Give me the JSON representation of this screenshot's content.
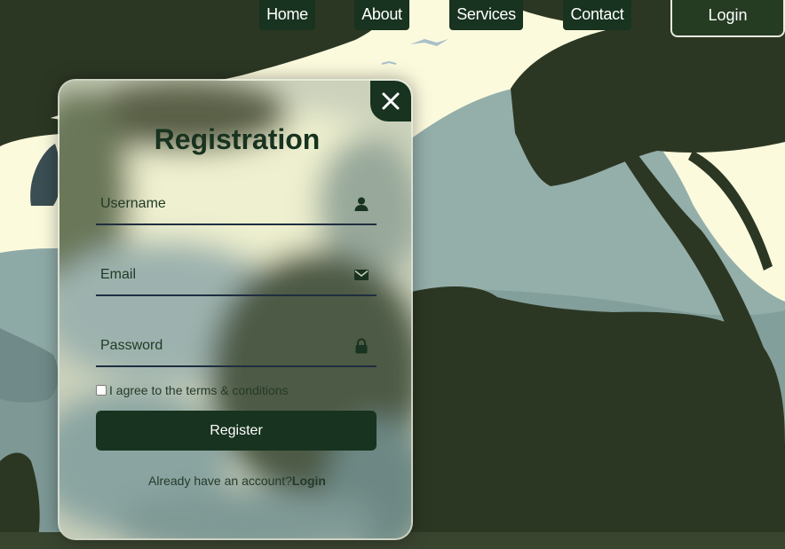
{
  "nav": {
    "items": [
      {
        "label": "Home"
      },
      {
        "label": "About"
      },
      {
        "label": "Services"
      },
      {
        "label": "Contact"
      }
    ],
    "login_label": "Login"
  },
  "form": {
    "title": "Registration",
    "username_placeholder": "Username",
    "email_placeholder": "Email",
    "password_placeholder": "Password",
    "agree_text": "I agree to the terms & conditions",
    "agree_checked": false,
    "register_label": "Register",
    "have_account_text": "Already have an account?",
    "login_link_label": "Login"
  },
  "icons": {
    "close": "close-icon",
    "username": "person-icon",
    "email": "envelope-icon",
    "password": "lock-icon"
  },
  "colors": {
    "primary": "#18331f",
    "background": "#fbfadd",
    "silhouette": "#2c3723",
    "hills": "#8fa8a4"
  }
}
